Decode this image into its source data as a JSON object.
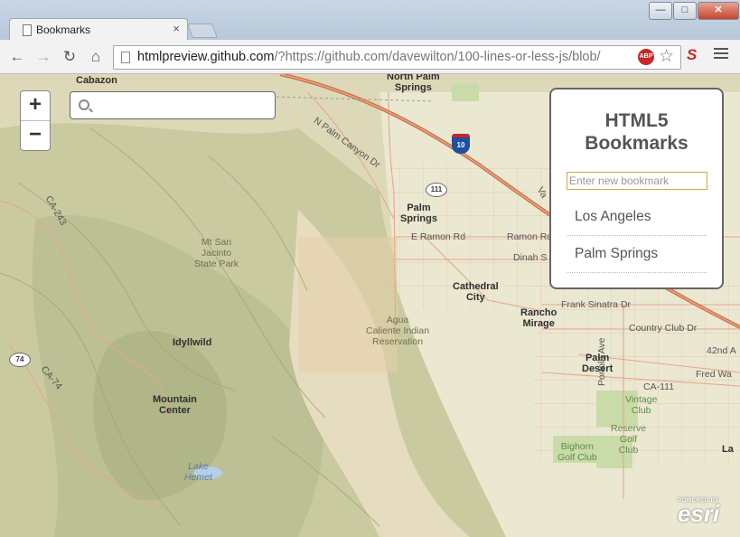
{
  "browser": {
    "tab_title": "Bookmarks",
    "tab_close": "×",
    "window_buttons": {
      "minimize": "—",
      "maximize": "□",
      "close": "✕"
    },
    "nav": {
      "back": "←",
      "forward": "→",
      "reload": "↻",
      "home": "⌂"
    },
    "url_host": "htmlpreview.github.com",
    "url_rest": "/?https://github.com/davewilton/100-lines-or-less-js/blob/",
    "adblock_label": "ABP",
    "star_icon": "☆",
    "extension_label": "S"
  },
  "map": {
    "zoom_in": "+",
    "zoom_out": "−",
    "search_placeholder": "",
    "attribution_powered": "POWERED BY",
    "attribution_name": "esri",
    "shields": {
      "i10": "10",
      "r111": "111",
      "r74": "74"
    },
    "labels": {
      "cabazon": "Cabazon",
      "north_palm_springs": "North Palm\nSprings",
      "n_palm_canyon": "N Palm Canyon Dr",
      "palm_springs": "Palm\nSprings",
      "e_ramon": "E Ramon Rd",
      "ramon_rd": "Ramon Rd",
      "dinah_s": "Dinah S",
      "cathedral_city": "Cathedral\nCity",
      "frank_sinatra": "Frank Sinatra Dr",
      "rancho_mirage": "Rancho\nMirage",
      "country_club": "Country Club Dr",
      "forty_second": "42nd A",
      "palm_desert": "Palm\nDesert",
      "portola": "Portola Ave",
      "fred_wa": "Fred Wa",
      "ca111": "CA-111",
      "vintage": "Vintage\nClub",
      "reserve": "Reserve\nGolf\nClub",
      "bighorn": "Bighorn\nGolf Club",
      "la": "La",
      "mt_san_jacinto": "Mt San\nJacinto\nState Park",
      "agua_caliente": "Agua\nCaliente Indian\nReservation",
      "idyllwild": "Idyllwild",
      "ca243": "CA-243",
      "ca74": "CA-74",
      "mountain_center": "Mountain\nCenter",
      "lake_hemet": "Lake\nHemet",
      "va": "Va"
    }
  },
  "bookmarks": {
    "title": "HTML5\nBookmarks",
    "input_placeholder": "Enter new bookmark",
    "items": [
      "Los Angeles",
      "Palm Springs"
    ]
  }
}
